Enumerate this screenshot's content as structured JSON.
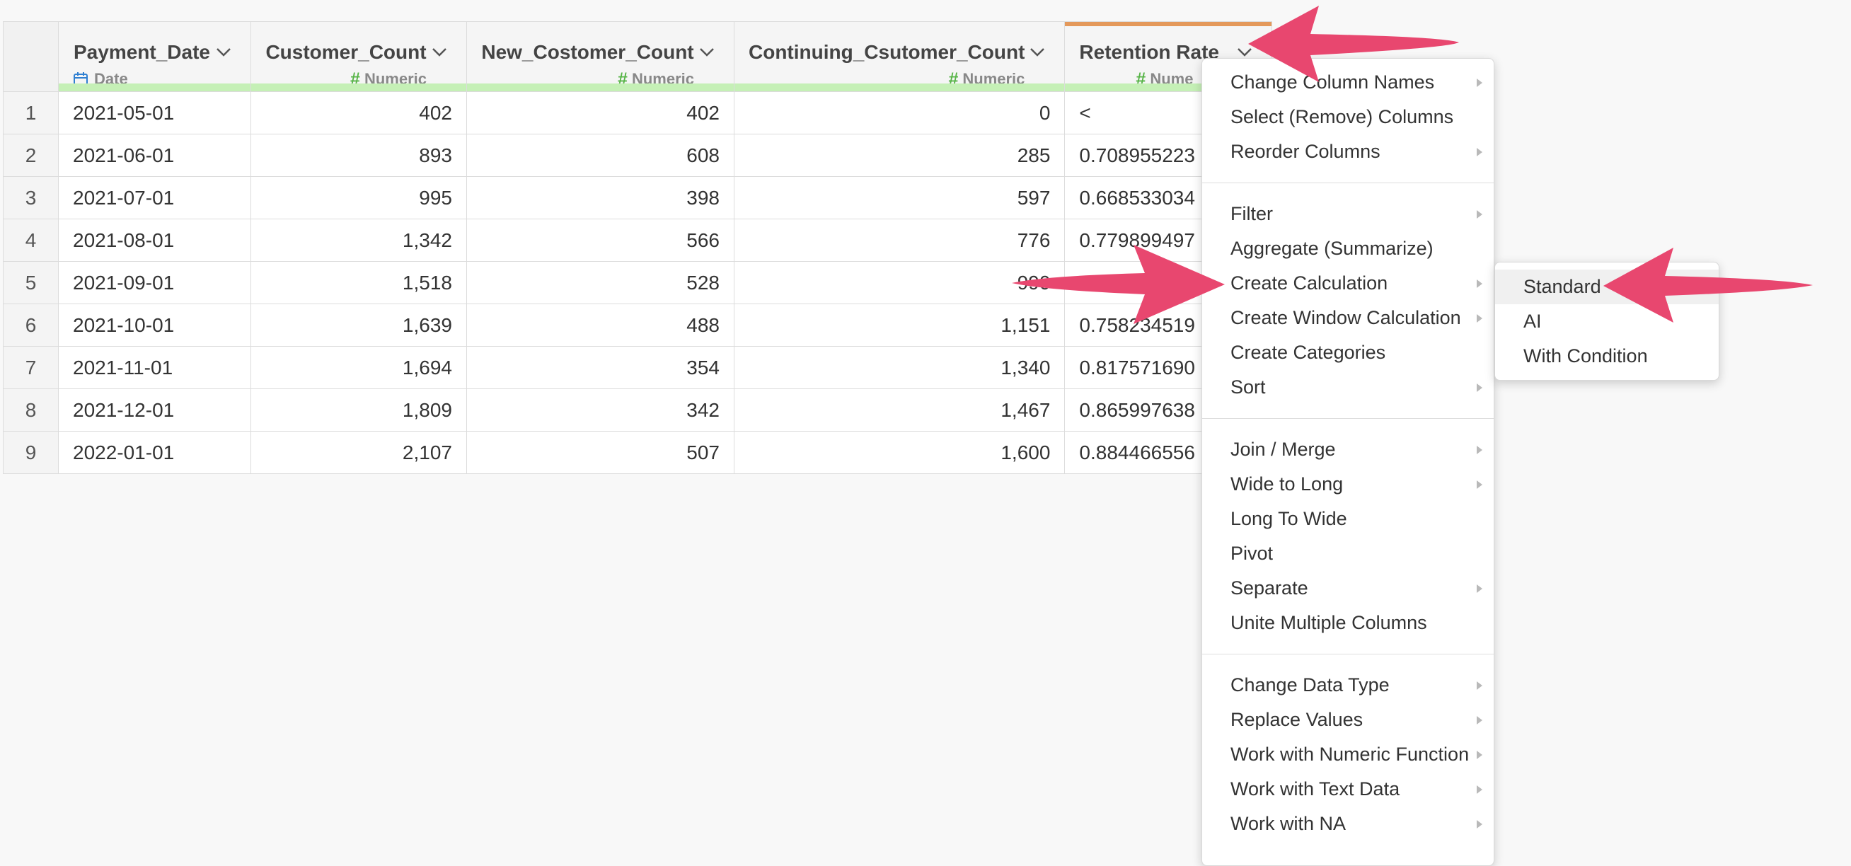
{
  "table": {
    "columns": [
      {
        "name": "Payment_Date",
        "type": "Date"
      },
      {
        "name": "Customer_Count",
        "type": "Numeric"
      },
      {
        "name": "New_Costomer_Count",
        "type": "Numeric"
      },
      {
        "name": "Continuing_Csutomer_Count",
        "type": "Numeric"
      },
      {
        "name": "Retention Rate",
        "type": "Nume"
      }
    ],
    "rows": [
      {
        "n": "1",
        "date": "2021-05-01",
        "cust": "402",
        "new": "402",
        "cont": "0",
        "ret": "<"
      },
      {
        "n": "2",
        "date": "2021-06-01",
        "cust": "893",
        "new": "608",
        "cont": "285",
        "ret": "0.708955223"
      },
      {
        "n": "3",
        "date": "2021-07-01",
        "cust": "995",
        "new": "398",
        "cont": "597",
        "ret": "0.668533034"
      },
      {
        "n": "4",
        "date": "2021-08-01",
        "cust": "1,342",
        "new": "566",
        "cont": "776",
        "ret": "0.779899497"
      },
      {
        "n": "5",
        "date": "2021-09-01",
        "cust": "1,518",
        "new": "528",
        "cont": "990",
        "ret": ""
      },
      {
        "n": "6",
        "date": "2021-10-01",
        "cust": "1,639",
        "new": "488",
        "cont": "1,151",
        "ret": "0.758234519"
      },
      {
        "n": "7",
        "date": "2021-11-01",
        "cust": "1,694",
        "new": "354",
        "cont": "1,340",
        "ret": "0.817571690"
      },
      {
        "n": "8",
        "date": "2021-12-01",
        "cust": "1,809",
        "new": "342",
        "cont": "1,467",
        "ret": "0.865997638"
      },
      {
        "n": "9",
        "date": "2022-01-01",
        "cust": "2,107",
        "new": "507",
        "cont": "1,600",
        "ret": "0.884466556"
      }
    ]
  },
  "menu": {
    "groups": [
      [
        {
          "label": "Change Column Names",
          "submenu": true
        },
        {
          "label": "Select (Remove) Columns",
          "submenu": false
        },
        {
          "label": "Reorder Columns",
          "submenu": true
        }
      ],
      [
        {
          "label": "Filter",
          "submenu": true
        },
        {
          "label": "Aggregate (Summarize)",
          "submenu": false
        },
        {
          "label": "Create Calculation",
          "submenu": true
        },
        {
          "label": "Create Window Calculation",
          "submenu": true
        },
        {
          "label": "Create Categories",
          "submenu": false
        },
        {
          "label": "Sort",
          "submenu": true
        }
      ],
      [
        {
          "label": "Join / Merge",
          "submenu": true
        },
        {
          "label": "Wide to Long",
          "submenu": true
        },
        {
          "label": "Long To Wide",
          "submenu": false
        },
        {
          "label": "Pivot",
          "submenu": false
        },
        {
          "label": "Separate",
          "submenu": true
        },
        {
          "label": "Unite Multiple Columns",
          "submenu": false
        }
      ],
      [
        {
          "label": "Change Data Type",
          "submenu": true
        },
        {
          "label": "Replace Values",
          "submenu": true
        },
        {
          "label": "Work with Numeric Function",
          "submenu": true
        },
        {
          "label": "Work with Text Data",
          "submenu": true
        },
        {
          "label": "Work with NA",
          "submenu": true
        }
      ]
    ]
  },
  "submenu": {
    "items": [
      "Standard",
      "AI",
      "With Condition"
    ],
    "highlighted": "Standard"
  },
  "colors": {
    "arrow": "#e8476f",
    "header_accent": "#e4995b",
    "quality_bar": "#c5f0b6",
    "numeric_icon": "#56b446",
    "date_icon": "#2f7fd1"
  }
}
